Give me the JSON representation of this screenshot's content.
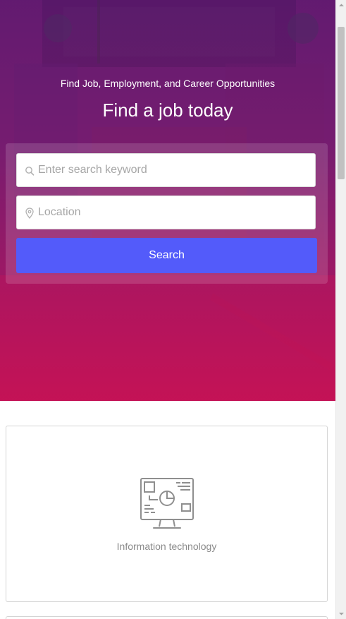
{
  "hero": {
    "subtitle": "Find Job, Employment, and Career Opportunities",
    "title": "Find a job today"
  },
  "search": {
    "keyword_placeholder": "Enter search keyword",
    "keyword_value": "",
    "location_placeholder": "Location",
    "location_value": "",
    "button_label": "Search",
    "button_color": "#535bfa",
    "icons": {
      "keyword": "search-icon",
      "location": "map-pin-icon"
    }
  },
  "categories": [
    {
      "label": "Information technology",
      "icon": "computer-monitor-icon"
    }
  ],
  "colors": {
    "hero_top": "#5e1a6c",
    "hero_bottom": "#d0124e"
  }
}
